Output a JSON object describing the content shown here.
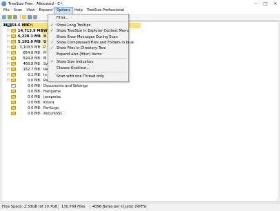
{
  "window": {
    "title": "TreeSize Free - Allocated - C:\\",
    "minimize": "–",
    "maximize": "□",
    "close": "×"
  },
  "menu": {
    "file": "File",
    "scan": "Scan",
    "view": "View",
    "expand": "Expand",
    "options": "Options",
    "help": "Help",
    "professional": "TreeSize Professional"
  },
  "options_menu": {
    "filter": "Filter...",
    "long_tooltips": "Show Long Tooltips",
    "explorer_context": "Show TreeSize In Explorer Context Menu",
    "error_messages": "Show Error Messages During Scan",
    "compressed_blue": "Show Compressed Files and Folders in blue",
    "files_in_tree": "Show Files in Directory Tree",
    "expand_filtered": "Expand also (filter) items",
    "size_indicators": "Show Size Indicators",
    "choose_gradient": "Choose Gradient...",
    "one_thread": "Scan with one Thread only"
  },
  "tree": {
    "root_size": "31,154.6 MB",
    "root_name": "C:\\",
    "rows": [
      {
        "size": "14,713.9 MB",
        "name": "W"
      },
      {
        "size": "6,220.1 MB",
        "name": "U"
      },
      {
        "size": "5,103.0 MB",
        "name": "U"
      },
      {
        "size": "3,103.5 MB",
        "name": "P"
      },
      {
        "size": "654.8 MB",
        "name": "Pr"
      },
      {
        "size": "524.8 MB",
        "name": "M"
      },
      {
        "size": "469.8 MB",
        "name": "Sy"
      },
      {
        "size": "152.7 MB",
        "name": "Re"
      },
      {
        "size": "0.1 MB",
        "name": "In"
      },
      {
        "size": "0.0 MB",
        "name": "Pe"
      },
      {
        "size": "0.0 MB",
        "name": "Documents and Settings"
      },
      {
        "size": "0.0 MB",
        "name": "Hangame"
      },
      {
        "size": "0.0 MB",
        "name": "jsoeperbs"
      },
      {
        "size": "0.0 MB",
        "name": "Kirara"
      },
      {
        "size": "0.0 MB",
        "name": "PerfLogs"
      },
      {
        "size": "0.0 MB",
        "name": "XecureSSL"
      }
    ]
  },
  "status": {
    "free_space": "Free Space: 2.33GB (of 29.7GB)",
    "files": "130,769  Files",
    "cluster": "4096 Bytes per Cluster (NTFS)"
  },
  "colors": {
    "bar_root": "#f7e27a",
    "bar_light": "#fbf1c0",
    "accent": "#1e5fa8",
    "menu_highlight": "#cce4f7"
  }
}
